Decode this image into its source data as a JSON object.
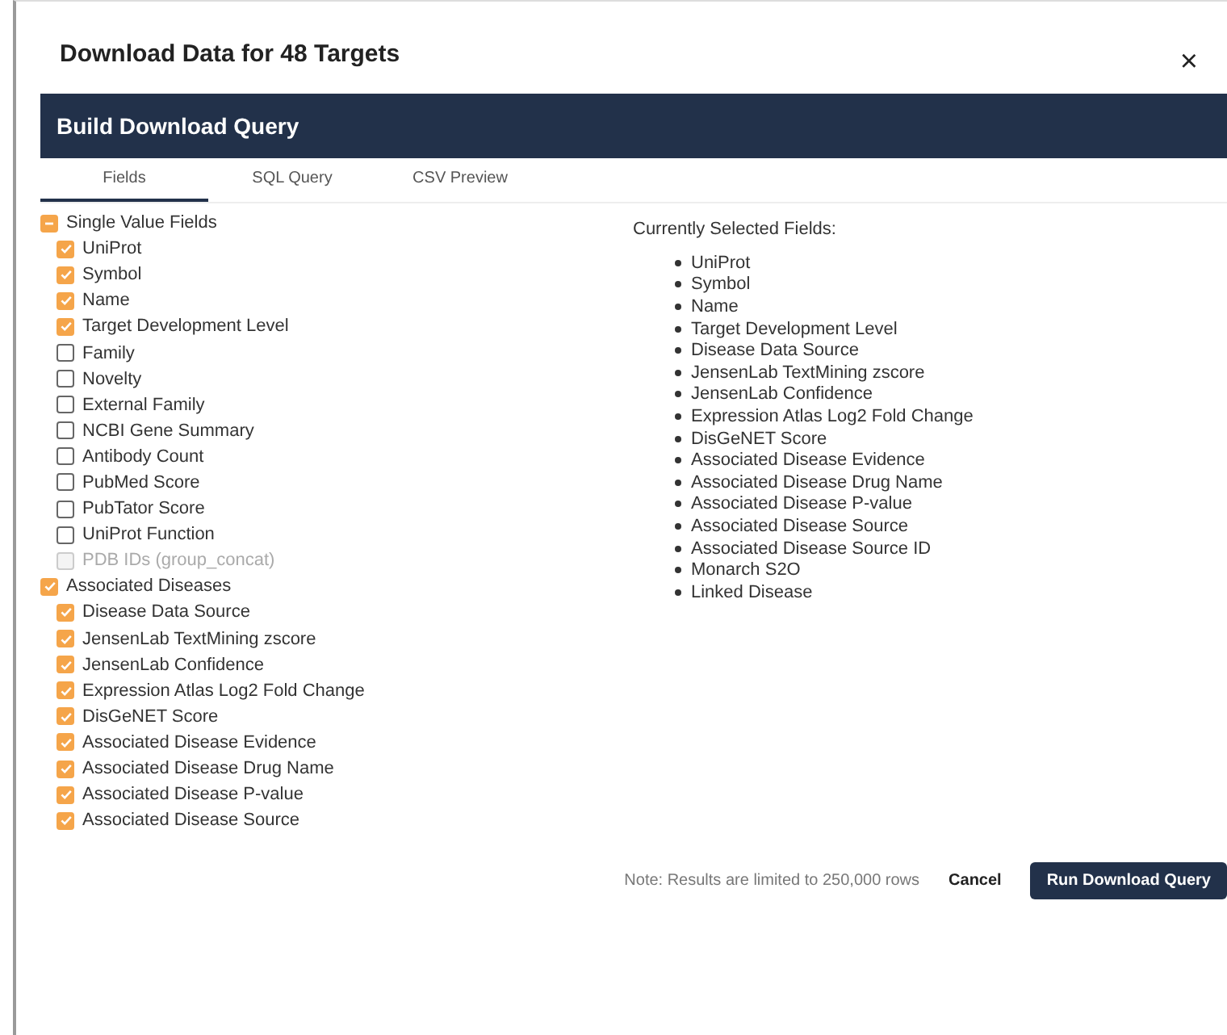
{
  "dialog": {
    "title": "Download Data for 48 Targets",
    "close": "×"
  },
  "header": {
    "title": "Build Download Query"
  },
  "tabs": [
    {
      "label": "Fields",
      "selected": true
    },
    {
      "label": "SQL Query",
      "selected": false
    },
    {
      "label": "CSV Preview",
      "selected": false
    }
  ],
  "field_groups": [
    {
      "label": "Single Value Fields",
      "checked": true,
      "indeterminate": true,
      "fields": [
        {
          "label": "UniProt",
          "checked": true,
          "disabled": false
        },
        {
          "label": "Symbol",
          "checked": true,
          "disabled": false
        },
        {
          "label": "Name",
          "checked": true,
          "disabled": false
        },
        {
          "label": "Target Development Level",
          "checked": true,
          "disabled": false
        },
        {
          "label": "Family",
          "checked": false,
          "disabled": false
        },
        {
          "label": "Novelty",
          "checked": false,
          "disabled": false
        },
        {
          "label": "External Family",
          "checked": false,
          "disabled": false
        },
        {
          "label": "NCBI Gene Summary",
          "checked": false,
          "disabled": false
        },
        {
          "label": "Antibody Count",
          "checked": false,
          "disabled": false
        },
        {
          "label": "PubMed Score",
          "checked": false,
          "disabled": false
        },
        {
          "label": "PubTator Score",
          "checked": false,
          "disabled": false
        },
        {
          "label": "UniProt Function",
          "checked": false,
          "disabled": false
        },
        {
          "label": "PDB IDs (group_concat)",
          "checked": false,
          "disabled": true
        }
      ]
    },
    {
      "label": "Associated Diseases",
      "checked": true,
      "indeterminate": false,
      "fields": [
        {
          "label": "Disease Data Source",
          "checked": true,
          "disabled": false
        },
        {
          "label": "JensenLab TextMining zscore",
          "checked": true,
          "disabled": false
        },
        {
          "label": "JensenLab Confidence",
          "checked": true,
          "disabled": false
        },
        {
          "label": "Expression Atlas Log2 Fold Change",
          "checked": true,
          "disabled": false
        },
        {
          "label": "DisGeNET Score",
          "checked": true,
          "disabled": false
        },
        {
          "label": "Associated Disease Evidence",
          "checked": true,
          "disabled": false
        },
        {
          "label": "Associated Disease Drug Name",
          "checked": true,
          "disabled": false
        },
        {
          "label": "Associated Disease P-value",
          "checked": true,
          "disabled": false
        },
        {
          "label": "Associated Disease Source",
          "checked": true,
          "disabled": false
        }
      ]
    }
  ],
  "selected_fields": {
    "title": "Currently Selected Fields:",
    "items": [
      "UniProt",
      "Symbol",
      "Name",
      "Target Development Level",
      "Disease Data Source",
      "JensenLab TextMining zscore",
      "JensenLab Confidence",
      "Expression Atlas Log2 Fold Change",
      "DisGeNET Score",
      "Associated Disease Evidence",
      "Associated Disease Drug Name",
      "Associated Disease P-value",
      "Associated Disease Source",
      "Associated Disease Source ID",
      "Monarch S2O",
      "Linked Disease"
    ]
  },
  "footer": {
    "note": "Note: Results are limited to 250,000 rows",
    "cancel": "Cancel",
    "run": "Run Download Query"
  }
}
